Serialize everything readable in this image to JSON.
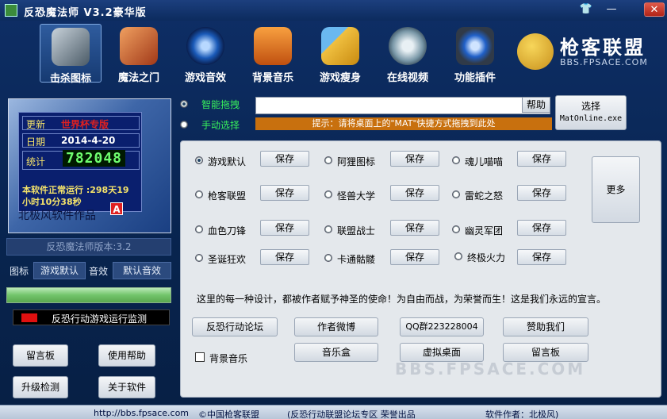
{
  "window": {
    "title": "反恐魔法师 V3.2豪华版"
  },
  "nav": {
    "items": [
      {
        "label": "击杀图标",
        "icon": "helmet-skull-icon",
        "color": "#6b7e8a"
      },
      {
        "label": "魔法之门",
        "icon": "spy-character-icon",
        "color": "#c85a28"
      },
      {
        "label": "游戏音效",
        "icon": "speaker-icon",
        "color": "#1a5ab8"
      },
      {
        "label": "背景音乐",
        "icon": "music-player-icon",
        "color": "#d8641a"
      },
      {
        "label": "游戏瘦身",
        "icon": "broom-icon",
        "color": "#d8a020"
      },
      {
        "label": "在线视频",
        "icon": "video-disc-icon",
        "color": "#9ab8c8"
      },
      {
        "label": "功能插件",
        "icon": "gear-plugin-icon",
        "color": "#2060c8"
      }
    ]
  },
  "logo": {
    "title": "枪客联盟",
    "subtitle": "BBS.FPSACE.COM"
  },
  "info": {
    "edition_key": "更新",
    "edition_val": "世界杯专版",
    "date_key": "日期",
    "date_val": "2014-4-20",
    "count_key": "统计",
    "count_val": "782048",
    "runtime_line1": "本软件正常运行 :298天19",
    "runtime_line2": "小时10分38秒",
    "author_tag": "北极风软件作品",
    "author_badge": "A"
  },
  "version_text": "反恐魔法师版本:3.2",
  "icon_row": {
    "icon_label": "图标",
    "icon_value": "游戏默认",
    "sound_label": "音效",
    "sound_value": "默认音效"
  },
  "progress": 1.0,
  "monitor_text": "反恐行动游戏运行监测",
  "left_buttons": {
    "board": "留言板",
    "help": "使用帮助",
    "upgrade": "升级检测",
    "about": "关于软件"
  },
  "drag": {
    "smart_label": "智能拖拽",
    "manual_label": "手动选择",
    "help": "帮助",
    "hint": "提示：请将桌面上的\"MAT\"快捷方式拖拽到此处",
    "choose_line1": "选择",
    "choose_line2": "MatOnline.exe"
  },
  "skins": {
    "save_label": "保存",
    "items": [
      {
        "label": "游戏默认",
        "selected": true
      },
      {
        "label": "阿狸图标",
        "selected": false
      },
      {
        "label": "魂儿喵喵",
        "selected": false
      },
      {
        "label": "枪客联盟",
        "selected": false
      },
      {
        "label": "怪兽大学",
        "selected": false
      },
      {
        "label": "雷蛇之怒",
        "selected": false
      },
      {
        "label": "血色刀锋",
        "selected": false
      },
      {
        "label": "联盟战士",
        "selected": false
      },
      {
        "label": "幽灵军团",
        "selected": false
      },
      {
        "label": "圣诞狂欢",
        "selected": false
      },
      {
        "label": "卡通骷髅",
        "selected": false
      },
      {
        "label": "终极火力",
        "selected": false
      }
    ],
    "more": "更多"
  },
  "slogan": "这里的每一种设计，都被作者赋予神圣的使命！为自由而战，为荣誉而生！这是我们永远的宣言。",
  "links": {
    "forum": "反恐行动论坛",
    "weibo": "作者微博",
    "qq": "QQ群223228004",
    "sponsor": "赞助我们",
    "bgm": "背景音乐",
    "musicbox": "音乐盒",
    "vdesk": "虚拟桌面",
    "board": "留言板"
  },
  "watermark": "BBS.FPSACE.COM",
  "status": {
    "url": "http://bbs.fpsace.com",
    "copyright": "©中国枪客联盟",
    "zone": "(反恐行动联盟论坛专区  荣誉出品",
    "author": "软件作者：北极风)"
  }
}
